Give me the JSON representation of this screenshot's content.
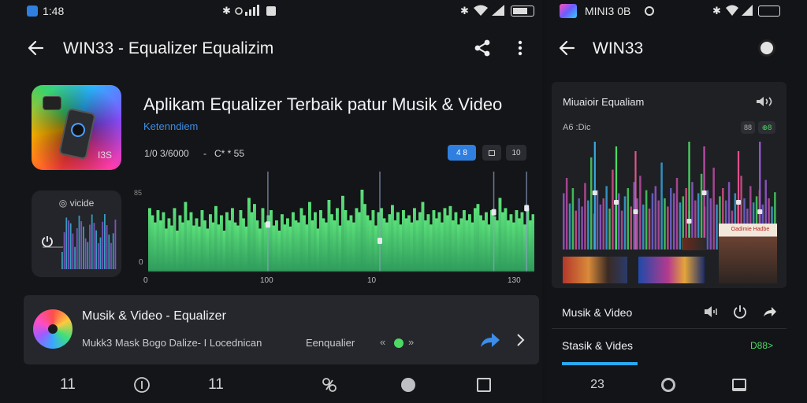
{
  "left": {
    "status": {
      "time": "1:48"
    },
    "appbar": {
      "title": "WIN33 - Equalizer Equalizim"
    },
    "hero": {
      "title": "Aplikam Equalizer Terbaik patur Musik & Video",
      "subtitle": "Ketenndiem"
    },
    "mini_card": {
      "label": "vicide"
    },
    "eq": {
      "info": "1/0 3/6000",
      "info_sep": "-",
      "info_value": "C* * 55",
      "chips": [
        "4 8",
        "",
        "10"
      ],
      "y_axis_top": "85",
      "y_axis_zero": "0",
      "x_ticks": [
        "0",
        "100",
        "10",
        "130"
      ],
      "bar_levels": [
        0.62,
        0.55,
        0.48,
        0.6,
        0.5,
        0.58,
        0.42,
        0.52,
        0.45,
        0.62,
        0.4,
        0.55,
        0.48,
        0.68,
        0.5,
        0.58,
        0.45,
        0.52,
        0.44,
        0.6,
        0.5,
        0.42,
        0.56,
        0.48,
        0.64,
        0.46,
        0.55,
        0.4,
        0.58,
        0.5,
        0.62,
        0.48,
        0.45,
        0.6,
        0.52,
        0.44,
        0.72,
        0.58,
        0.66,
        0.5,
        0.42,
        0.62,
        0.48,
        0.55,
        0.6,
        0.45,
        0.5,
        0.4,
        0.56,
        0.46,
        0.52,
        0.44,
        0.58,
        0.5,
        0.48,
        0.62,
        0.55,
        0.46,
        0.68,
        0.5,
        0.58,
        0.42,
        0.6,
        0.52,
        0.48,
        0.7,
        0.56,
        0.5,
        0.62,
        0.45,
        0.74,
        0.6,
        0.5,
        0.55,
        0.48,
        0.62,
        0.58,
        0.8,
        0.66,
        0.55,
        0.5,
        0.6,
        0.45,
        0.58,
        0.62,
        0.52,
        0.48,
        0.56,
        0.65,
        0.5,
        0.58,
        0.46,
        0.6,
        0.52,
        0.55,
        0.48,
        0.62,
        0.5,
        0.58,
        0.68,
        0.5,
        0.56,
        0.46,
        0.6,
        0.52,
        0.58,
        0.48,
        0.62,
        0.55,
        0.64,
        0.5,
        0.58,
        0.46,
        0.52,
        0.6,
        0.5,
        0.56,
        0.48,
        0.62,
        0.66,
        0.55,
        0.5,
        0.58,
        0.46,
        0.6,
        0.54,
        0.5,
        0.72,
        0.58,
        0.62,
        0.5,
        0.56,
        0.48,
        0.6,
        0.52,
        0.58,
        0.46,
        0.62,
        0.5,
        0.56
      ],
      "slider_levels": [
        0.46,
        0.3,
        0.58,
        0.62
      ],
      "accent_blue": "#2f7fe0",
      "accent_green": "#4cd964"
    },
    "now_playing": {
      "title": "Musik & Video - Equalizer",
      "subtitle": "Mukk3 Mask Bogo Dalize- I Locednican",
      "extra": "Eenqualier"
    },
    "nav": [
      "11",
      "",
      "11",
      "",
      "",
      ""
    ]
  },
  "right": {
    "status": {
      "title": "MINI3 0B"
    },
    "appbar": {
      "title": "WIN33"
    },
    "eq_card": {
      "title": "Miuaioir Equaliam",
      "info": "A6 :Dic",
      "bar_levels": [
        0.55,
        0.7,
        0.45,
        0.6,
        0.38,
        0.5,
        0.42,
        0.65,
        0.48,
        0.9,
        0.35,
        0.58,
        0.44,
        0.5,
        0.62,
        0.4,
        0.78,
        0.46,
        0.55,
        0.38,
        0.52,
        0.6,
        0.42,
        0.66,
        0.5,
        0.72,
        0.44,
        0.58,
        0.4,
        0.55,
        0.62,
        0.48,
        0.85,
        0.5,
        0.42,
        0.6,
        0.55,
        0.7,
        0.46,
        0.52,
        0.6,
        0.38,
        0.66,
        0.48,
        0.55,
        0.74,
        0.42,
        0.58,
        0.5,
        0.8,
        0.44,
        0.52,
        0.6,
        0.48,
        0.66,
        0.38,
        0.55,
        0.45,
        0.72,
        0.5,
        0.4,
        0.62,
        0.46,
        0.52,
        0.58,
        0.44,
        0.68,
        0.5,
        0.42,
        0.56
      ]
    },
    "thumb_poster_text": "Oadimie Hadbe",
    "list": {
      "item1": "Musik & Video",
      "item2": "Stasik & Vides",
      "item2_badge": "D88>"
    },
    "nav": [
      "23",
      "",
      ""
    ]
  }
}
